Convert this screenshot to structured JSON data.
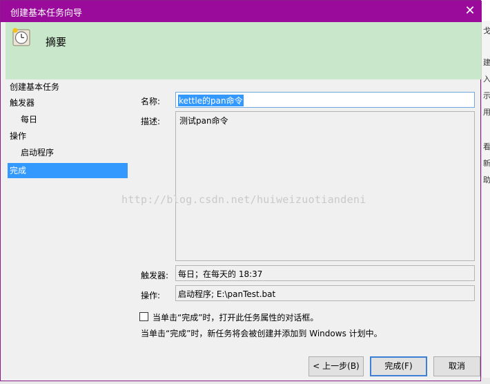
{
  "window": {
    "title": "创建基本任务向导"
  },
  "header": {
    "title": "摘要"
  },
  "nav": [
    {
      "label": "创建基本任务",
      "indent": false,
      "selected": false
    },
    {
      "label": "触发器",
      "indent": false,
      "selected": false
    },
    {
      "label": "每日",
      "indent": true,
      "selected": false
    },
    {
      "label": "操作",
      "indent": false,
      "selected": false
    },
    {
      "label": "启动程序",
      "indent": true,
      "selected": false
    },
    {
      "label": "完成",
      "indent": false,
      "selected": true
    }
  ],
  "form": {
    "name_label": "名称:",
    "name_value": "kettle的pan命令",
    "desc_label": "描述:",
    "desc_value": "测试pan命令",
    "trigger_label": "触发器:",
    "trigger_value": "每日；在每天的 18:37",
    "action_label": "操作:",
    "action_value": "启动程序; E:\\panTest.bat"
  },
  "watermark": "http://blog.csdn.net/huiweizuotiandeni",
  "checkbox": {
    "label": "当单击“完成”时，打开此任务属性的对话框。",
    "checked": false
  },
  "note": "当单击“完成”时，新任务将会被创建并添加到 Windows 计划中。",
  "buttons": {
    "back": "< 上一步(B)",
    "finish": "完成(F)",
    "cancel": "取消"
  },
  "background_fragments": [
    "戈",
    "建",
    "入",
    "示",
    "用",
    "看",
    "新",
    "助"
  ],
  "colors": {
    "titlebar": "#9b0b9b",
    "header": "#c9e8cb",
    "selection": "#3399ff"
  }
}
